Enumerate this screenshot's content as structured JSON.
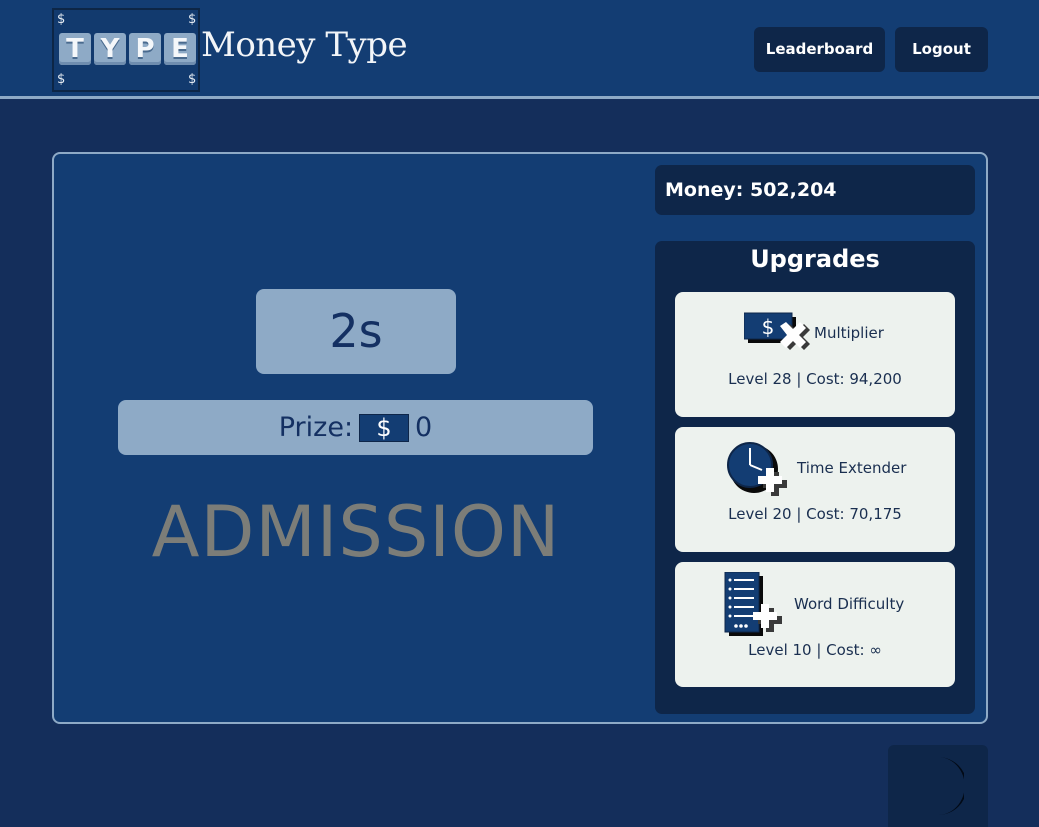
{
  "header": {
    "logo_text": "TYPE",
    "logo_letters": [
      "T",
      "Y",
      "P",
      "E"
    ],
    "logo_symbol": "$",
    "brand_name": "Money Type",
    "nav": {
      "leaderboard_label": "Leaderboard",
      "logout_label": "Logout"
    }
  },
  "game": {
    "timer": "2s",
    "prize_label": "Prize:",
    "prize_symbol": "$",
    "prize_value": "0",
    "word": "ADMISSION"
  },
  "sidebar": {
    "money_label": "Money: 502,204",
    "upgrades_title": "Upgrades",
    "upgrades": [
      {
        "name": "Multiplier",
        "info": "Level 28 | Cost: 94,200",
        "icon": "money-multiplier-icon"
      },
      {
        "name": "Time Extender",
        "info": "Level 20 | Cost: 70,175",
        "icon": "clock-plus-icon"
      },
      {
        "name": "Word Difficulty",
        "info": "Level 10 | Cost: ∞",
        "icon": "word-list-plus-icon"
      }
    ]
  },
  "theme_toggle": {
    "icon": "moon-icon"
  },
  "colors": {
    "background": "#142e5b",
    "header": "#133d73",
    "panel_border": "#8eaac6",
    "dark_box": "#0e2649",
    "card": "#edf2ee",
    "word": "#7c7d78"
  }
}
